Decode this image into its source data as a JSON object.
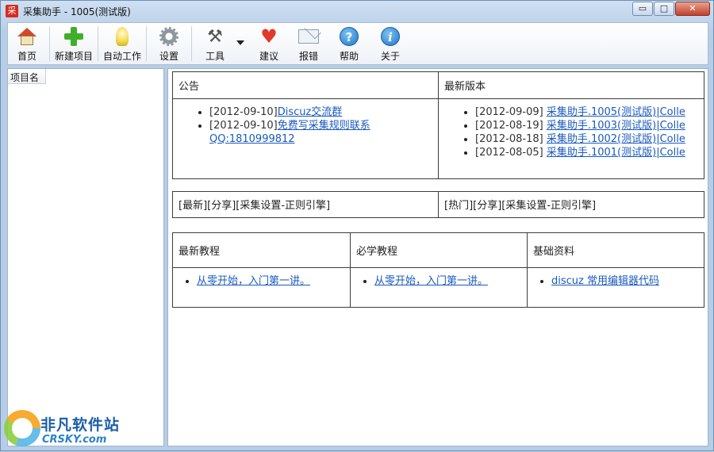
{
  "window": {
    "title": "采集助手 - 1005(测试版)",
    "app_icon_char": "采",
    "controls": {
      "minimize": "▭",
      "maximize": "□",
      "close": "✕"
    }
  },
  "toolbar": {
    "items": [
      {
        "label": "首页",
        "icon": "home-icon"
      },
      {
        "label": "新建项目",
        "icon": "plus-icon"
      },
      {
        "label": "自动工作",
        "icon": "lightbulb-icon"
      },
      {
        "label": "设置",
        "icon": "gear-icon"
      },
      {
        "label": "工具",
        "icon": "tools-icon"
      },
      {
        "label": "建议",
        "icon": "heart-icon"
      },
      {
        "label": "报错",
        "icon": "mail-icon"
      },
      {
        "label": "帮助",
        "icon": "help-icon"
      },
      {
        "label": "关于",
        "icon": "info-icon"
      }
    ],
    "help_glyph": "?",
    "info_glyph": "i"
  },
  "left_panel": {
    "column_header": "项目名"
  },
  "announcements": {
    "header": "公告",
    "items": [
      {
        "date": "[2012-09-10]",
        "link": "Discuz交流群"
      },
      {
        "date": "[2012-09-10]",
        "link": "免费写采集规则联系QQ:1810999812"
      }
    ]
  },
  "latest_versions": {
    "header": "最新版本",
    "items": [
      {
        "date": "[2012-09-09]",
        "link": "采集助手.1005(测试版)|Colle"
      },
      {
        "date": "[2012-08-19]",
        "link": "采集助手.1003(测试版)|Colle"
      },
      {
        "date": "[2012-08-18]",
        "link": "采集助手.1002(测试版)|Colle"
      },
      {
        "date": "[2012-08-05]",
        "link": "采集助手.1001(测试版)|Colle"
      }
    ]
  },
  "rules": {
    "left": "[最新][分享][采集设置-正则引擎]",
    "right": "[热门][分享][采集设置-正则引擎]"
  },
  "tutorials": {
    "columns": [
      {
        "header": "最新教程",
        "link": "从零开始，入门第一讲。"
      },
      {
        "header": "必学教程",
        "link": "从零开始，入门第一讲。"
      },
      {
        "header": "基础资料",
        "link": "discuz 常用编辑器代码"
      }
    ]
  },
  "watermark": {
    "cn": "非凡软件站",
    "en": "CRSKY.com"
  }
}
